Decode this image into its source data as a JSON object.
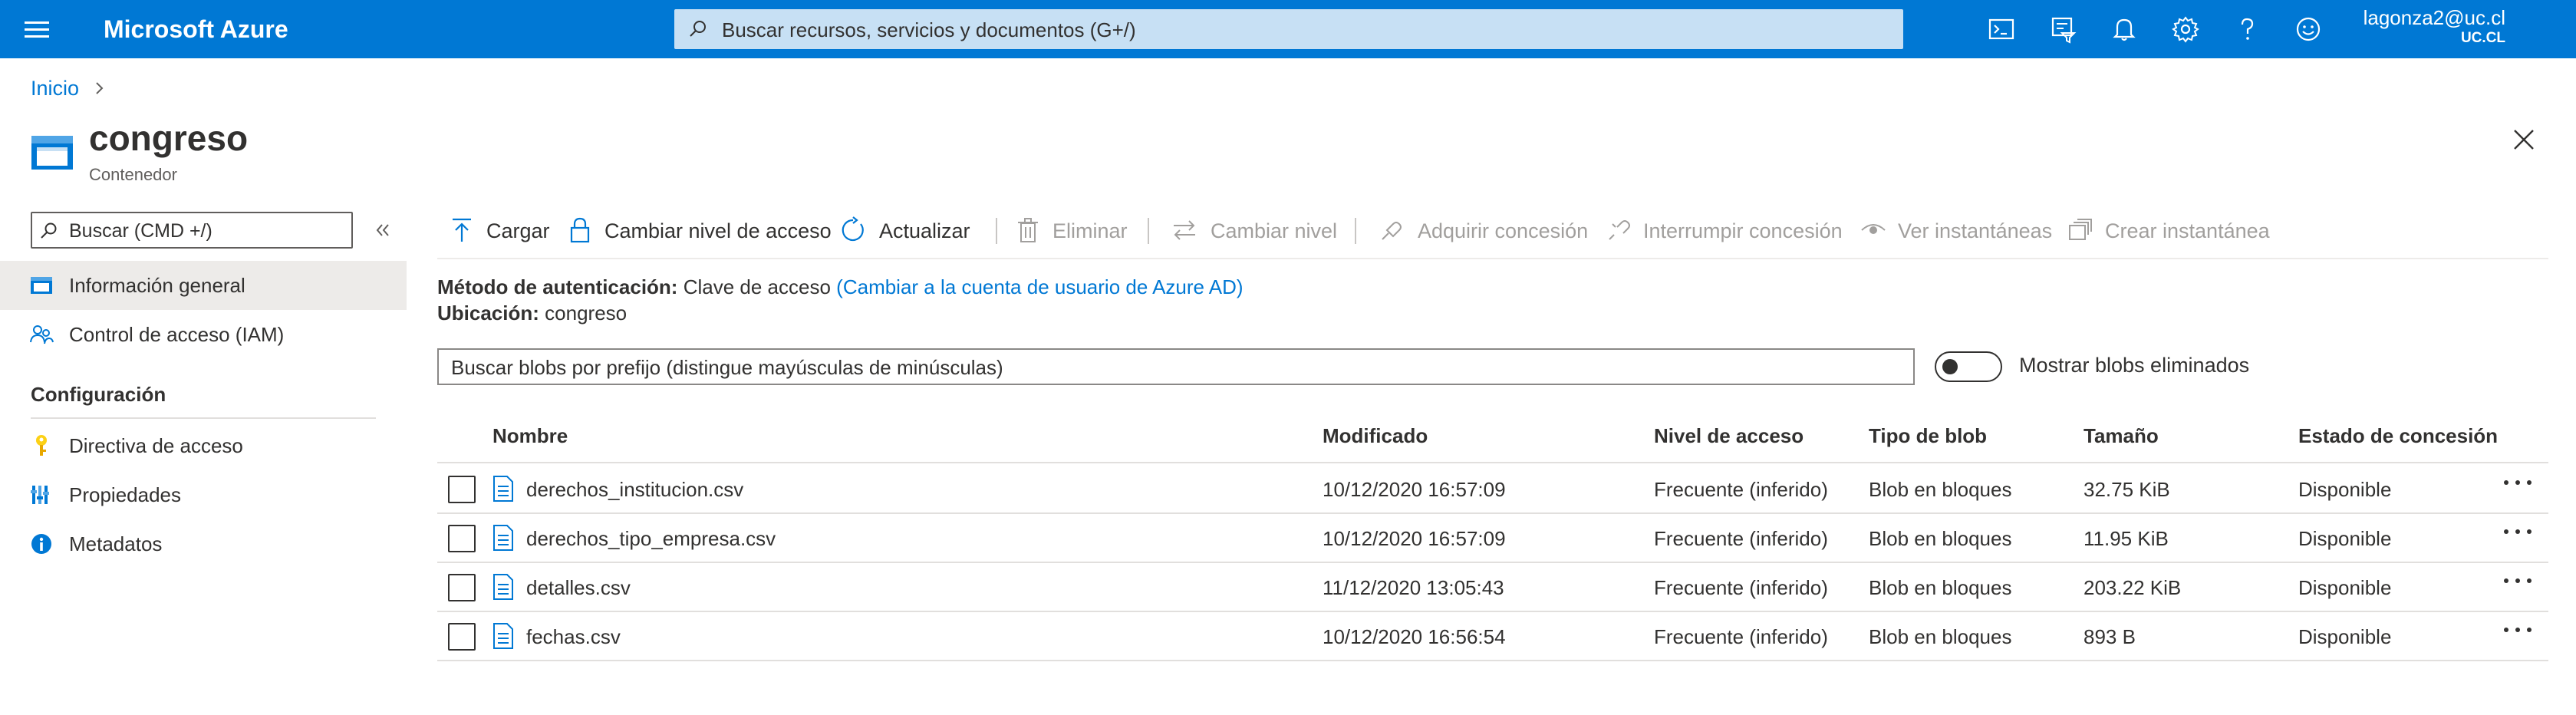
{
  "topbar": {
    "brand": "Microsoft Azure",
    "search_placeholder": "Buscar recursos, servicios y documentos (G+/)",
    "user_email": "lagonza2@uc.cl",
    "user_org": "UC.CL",
    "icons": [
      "cloud-shell-icon",
      "directory-filter-icon",
      "notifications-icon",
      "settings-icon",
      "help-icon",
      "feedback-icon"
    ]
  },
  "breadcrumb": {
    "home": "Inicio"
  },
  "header": {
    "title": "congreso",
    "subtitle": "Contenedor"
  },
  "sidebar": {
    "search_placeholder": "Buscar (CMD +/)",
    "items": [
      {
        "label": "Información general",
        "icon": "overview-icon",
        "active": true
      },
      {
        "label": "Control de acceso (IAM)",
        "icon": "iam-icon",
        "active": false
      }
    ],
    "section": "Configuración",
    "settings_items": [
      {
        "label": "Directiva de acceso",
        "icon": "key-icon"
      },
      {
        "label": "Propiedades",
        "icon": "properties-icon"
      },
      {
        "label": "Metadatos",
        "icon": "info-icon"
      }
    ]
  },
  "toolbar": {
    "upload": "Cargar",
    "change_access_level": "Cambiar nivel de acceso",
    "refresh": "Actualizar",
    "delete": "Eliminar",
    "change_tier": "Cambiar nivel",
    "acquire_lease": "Adquirir concesión",
    "break_lease": "Interrumpir concesión",
    "view_snapshots": "Ver instantáneas",
    "create_snapshot": "Crear instantánea"
  },
  "properties": {
    "auth_label": "Método de autenticación:",
    "auth_value": "Clave de acceso",
    "auth_link": "(Cambiar a la cuenta de usuario de Azure AD)",
    "location_label": "Ubicación:",
    "location_value": "congreso"
  },
  "blob_search": {
    "placeholder": "Buscar blobs por prefijo (distingue mayúsculas de minúsculas)",
    "show_deleted_label": "Mostrar blobs eliminados",
    "show_deleted": false
  },
  "table": {
    "columns": [
      "Nombre",
      "Modificado",
      "Nivel de acceso",
      "Tipo de blob",
      "Tamaño",
      "Estado de concesión"
    ],
    "rows": [
      {
        "name": "derechos_institucion.csv",
        "modified": "10/12/2020 16:57:09",
        "access": "Frecuente (inferido)",
        "type": "Blob en bloques",
        "size": "32.75 KiB",
        "lease": "Disponible"
      },
      {
        "name": "derechos_tipo_empresa.csv",
        "modified": "10/12/2020 16:57:09",
        "access": "Frecuente (inferido)",
        "type": "Blob en bloques",
        "size": "11.95 KiB",
        "lease": "Disponible"
      },
      {
        "name": "detalles.csv",
        "modified": "11/12/2020 13:05:43",
        "access": "Frecuente (inferido)",
        "type": "Blob en bloques",
        "size": "203.22 KiB",
        "lease": "Disponible"
      },
      {
        "name": "fechas.csv",
        "modified": "10/12/2020 16:56:54",
        "access": "Frecuente (inferido)",
        "type": "Blob en bloques",
        "size": "893 B",
        "lease": "Disponible"
      }
    ]
  },
  "colors": {
    "brand": "#0078d4",
    "search_bg": "#c7e0f4",
    "disabled_text": "#a19f9d",
    "nav_active": "#edebe9"
  }
}
